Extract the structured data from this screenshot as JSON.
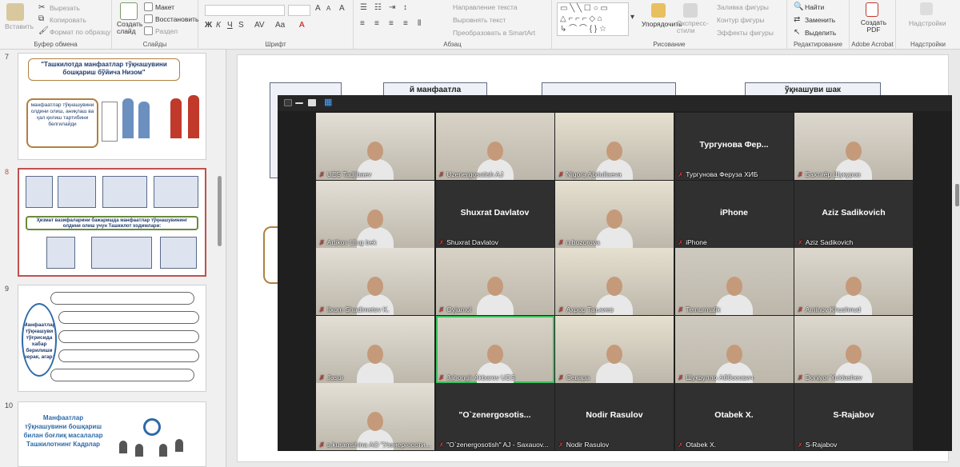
{
  "ribbon": {
    "clipboard": {
      "paste": "Вставить",
      "cut": "Вырезать",
      "copy": "Копировать",
      "format_painter": "Формат по образцу",
      "group_label": "Буфер обмена"
    },
    "slides": {
      "new_slide": "Создать слайд",
      "layout": "Макет",
      "reset": "Восстановить",
      "section": "Раздел",
      "group_label": "Слайды"
    },
    "font": {
      "bold": "Ж",
      "italic": "К",
      "underline": "Ч",
      "strike": "S",
      "group_label": "Шрифт"
    },
    "paragraph": {
      "text_direction": "Направление текста",
      "align_text": "Выровнять текст",
      "smartart": "Преобразовать в SmartArt",
      "group_label": "Абзац"
    },
    "drawing": {
      "arrange": "Упорядочить",
      "quick_styles": "Экспресс-стили",
      "shape_fill": "Заливка фигуры",
      "shape_outline": "Контур фигуры",
      "shape_effects": "Эффекты фигуры",
      "group_label": "Рисование"
    },
    "editing": {
      "find": "Найти",
      "replace": "Заменить",
      "select": "Выделить",
      "group_label": "Редактирование"
    },
    "acrobat": {
      "create_pdf": "Создать PDF",
      "group_label": "Adobe Acrobat"
    },
    "addins": {
      "addins": "Надстройки",
      "group_label": "Надстройки"
    }
  },
  "thumbnails": [
    {
      "number": "7",
      "title": "\"Ташкилотда манфаатлар тўқнашувини бошқариш бўйича Низом\"",
      "box_text": "манфаатлар тўқнашувини олдини олиш, аниқлаш ва ҳал қилиш тартибини белгилайди"
    },
    {
      "number": "8",
      "title": "Ҳизмат вазифаларини бажаришда манфаатлар тўқнашувининг олдини олиш учун Ташкилот ходимлари:"
    },
    {
      "number": "9",
      "title": "Манфаатлар тўқнашуви тўғрисида хабар берилиши керак, агар:"
    },
    {
      "number": "10",
      "title": "Манфаатлар тўқнашувини бошқариш билан боғлиқ масалалар Ташкилотнинг Кадрлар"
    }
  ],
  "slide": {
    "box_1_text": "й манфаатла",
    "box_3_text": "ўқнашуви шак"
  },
  "meeting": {
    "participants": [
      {
        "name": "UES Tadjibaev",
        "camera": true
      },
      {
        "name": "Uzenergosotish AJ",
        "camera": true
      },
      {
        "name": "Nigora Abdullaeva",
        "camera": true
      },
      {
        "name": "Тургунова Феруза ХИБ",
        "camera": false,
        "display": "Тургунова Фер..."
      },
      {
        "name": "Бахтиёр Шукуров",
        "camera": true
      },
      {
        "name": "Artikov Ulug bek",
        "camera": true
      },
      {
        "name": "Shuxrat Davlatov",
        "camera": false,
        "display": "Shuxrat Davlatov"
      },
      {
        "name": "n.bozorova",
        "camera": true
      },
      {
        "name": "iPhone",
        "camera": false,
        "display": "iPhone"
      },
      {
        "name": "Aziz Sadikovich",
        "camera": false,
        "display": "Aziz Sadikovich"
      },
      {
        "name": "Ilxom Shadimetov K.",
        "camera": true
      },
      {
        "name": "Oyjamol",
        "camera": true
      },
      {
        "name": "Ахрор Таъкиев",
        "camera": true
      },
      {
        "name": "Temurmalik",
        "camera": true
      },
      {
        "name": "Aminov Khushnud",
        "camera": true
      },
      {
        "name": "Jasur",
        "camera": true
      },
      {
        "name": "Jahongir Akbarov UES",
        "camera": true,
        "active": true
      },
      {
        "name": "Севара",
        "camera": true
      },
      {
        "name": "Шукрулло Аббосович",
        "camera": true
      },
      {
        "name": "Doniyor Yuldashev",
        "camera": true
      },
      {
        "name": "s.kuramshina AO \"Узэнергосоти...",
        "camera": true
      },
      {
        "name": "\"O`zenergosotish\" AJ - Saxauov...",
        "camera": false,
        "display": "\"O`zenergosotis..."
      },
      {
        "name": "Nodir Rasulov",
        "camera": false,
        "display": "Nodir Rasulov"
      },
      {
        "name": "Otabek X.",
        "camera": false,
        "display": "Otabek X."
      },
      {
        "name": "S-Rajabov",
        "camera": false,
        "display": "S-Rajabov"
      }
    ]
  },
  "colors": {
    "accent_red": "#c0504d",
    "active_speaker": "#3ac15e",
    "zoom_bg": "#1f1f1f"
  }
}
